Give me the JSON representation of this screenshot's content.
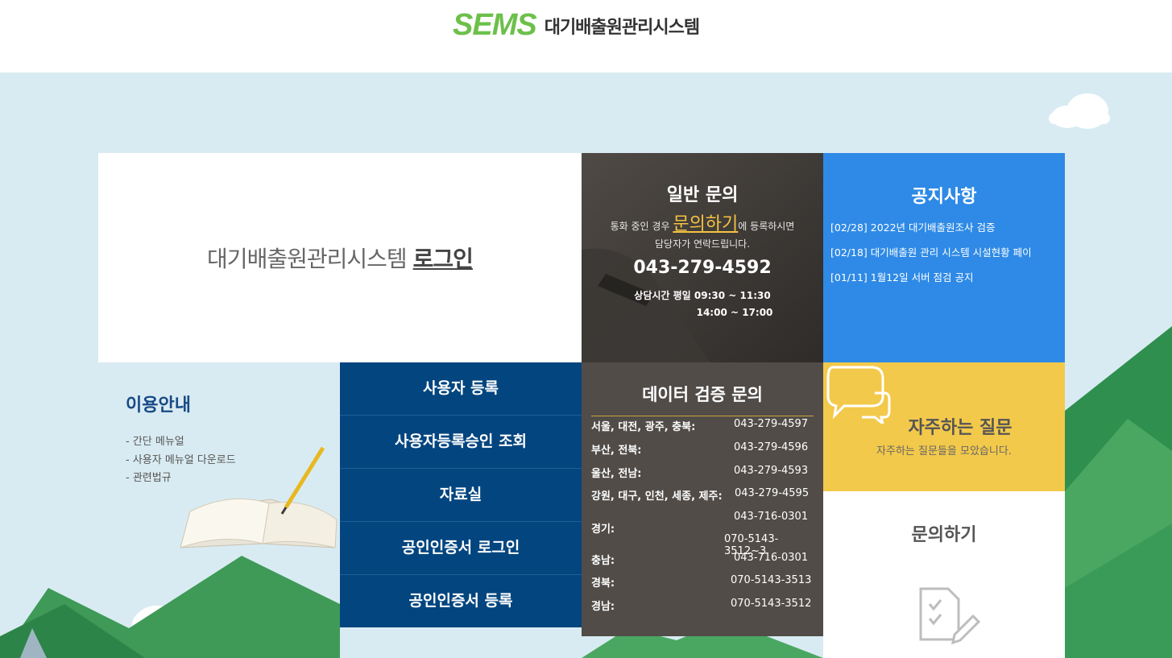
{
  "header": {
    "logo": "SEMS",
    "system_name": "대기배출원관리시스템"
  },
  "login": {
    "prefix": "대기배출원관리시스템",
    "link": "로그인"
  },
  "general_inquiry": {
    "title": "일반 문의",
    "desc_pre": "통화 중인 경우",
    "desc_link": "문의하기",
    "desc_post": "에 등록하시면",
    "desc_line2": "담당자가 연락드립니다.",
    "phone": "043-279-4592",
    "hours_label": "상담시간 평일 09:30 ~ 11:30",
    "hours_2": "14:00 ~ 17:00"
  },
  "notice": {
    "title": "공지사항",
    "items": [
      {
        "text": "[02/28] 2022년 대기배출원조사 검증"
      },
      {
        "text": "[02/18] 대기배출원 관리 시스템 시설현황 페이"
      },
      {
        "text": "[01/11] 1월12일 서버 점검 공지"
      }
    ]
  },
  "guide": {
    "title": "이용안내",
    "items": [
      "- 간단 메뉴얼",
      "- 사용자 메뉴얼 다운로드",
      "- 관련법규"
    ]
  },
  "menu": {
    "items": [
      "사용자 등록",
      "사용자등록승인 조회",
      "자료실",
      "공인인증서 로그인",
      "공인인증서 등록"
    ]
  },
  "data_inquiry": {
    "title": "데이터 검증 문의",
    "rows": [
      {
        "region": "서울, 대전, 광주, 충북:",
        "numbers": [
          "043-279-4597"
        ]
      },
      {
        "region": "부산, 전북:",
        "numbers": [
          "043-279-4596"
        ]
      },
      {
        "region": "울산, 전남:",
        "numbers": [
          "043-279-4593"
        ]
      },
      {
        "region": "강원, 대구, 인천, 세종, 제주:",
        "numbers": [
          "043-279-4595"
        ]
      },
      {
        "region": "경기:",
        "numbers": [
          "043-716-0301",
          "070-5143-3512~3"
        ]
      },
      {
        "region": "충남:",
        "numbers": [
          "043-716-0301"
        ]
      },
      {
        "region": "경북:",
        "numbers": [
          "070-5143-3513"
        ]
      },
      {
        "region": "경남:",
        "numbers": [
          "070-5143-3512"
        ]
      }
    ]
  },
  "faq": {
    "title": "자주하는 질문",
    "desc": "자주하는 질문들을 모았습니다."
  },
  "ask": {
    "title": "문의하기"
  },
  "colors": {
    "brand_green": "#6cc04a",
    "navy": "#02457f",
    "blue": "#2e8ae6",
    "yellow": "#f3c94b",
    "dark": "#514c48",
    "sky": "#d9ebf2"
  }
}
